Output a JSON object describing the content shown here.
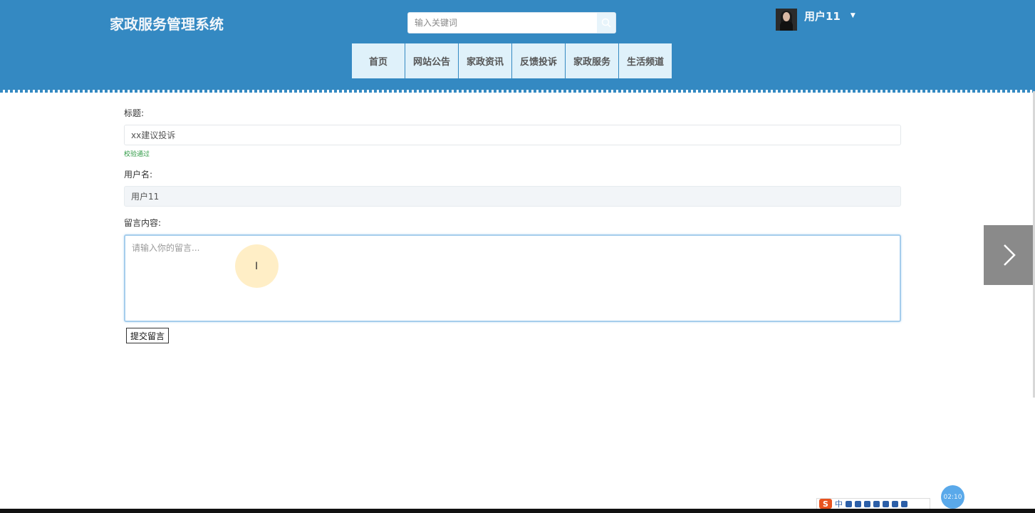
{
  "header": {
    "site_title": "家政服务管理系统",
    "search_placeholder": "输入关键词",
    "user": {
      "name": "用户11"
    }
  },
  "nav": {
    "items": [
      "首页",
      "网站公告",
      "家政资讯",
      "反馈投诉",
      "家政服务",
      "生活频道"
    ]
  },
  "form": {
    "title_label": "标题:",
    "title_value": "xx建议投诉",
    "title_validation": "校验通过",
    "username_label": "用户名:",
    "username_value": "用户11",
    "content_label": "留言内容:",
    "content_placeholder": "请输入你的留言...",
    "submit_label": "提交留言"
  },
  "ime_toolbar": {
    "mode_label": "中"
  },
  "recording_timer": "02:10",
  "colors": {
    "header_bg": "#3489c2",
    "nav_bg": "#dff1fa",
    "validation_ok": "#2f9a45",
    "focus_border": "#a5cdec"
  }
}
